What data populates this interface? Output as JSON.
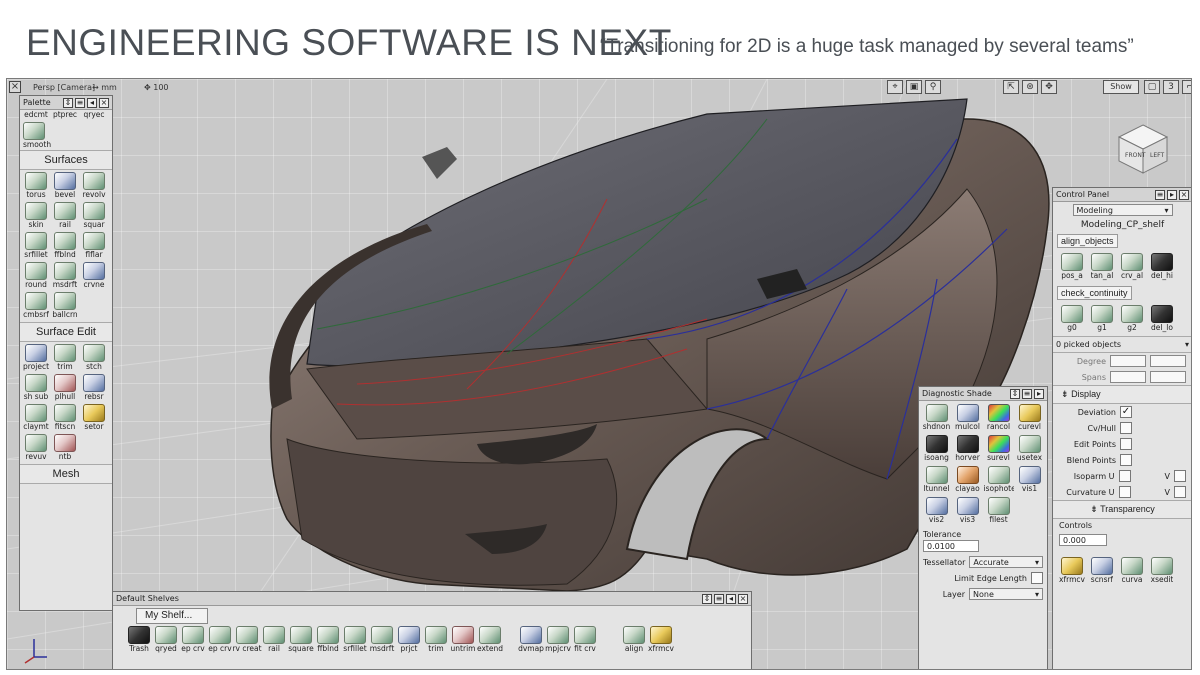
{
  "slide": {
    "title": "ENGINEERING SOFTWARE IS NEXT",
    "quote": "“Transitioning for 2D is a huge task managed by several teams”"
  },
  "viewport": {
    "camera_label": "Persp [Camera]",
    "units": "↔ mm",
    "zoom": "100",
    "show_button": "Show",
    "cube_front": "FRONT",
    "cube_left": "LEFT",
    "x_icon": "close-viewport-icon"
  },
  "palette": {
    "title": "Palette",
    "top_row": [
      "edcmt",
      "ptprec",
      "qryec"
    ],
    "smooth": "smooth",
    "surfaces_title": "Surfaces",
    "surfaces": [
      "torus",
      "bevel",
      "revolv",
      "skin",
      "rail",
      "squar",
      "srfillet",
      "ffblnd",
      "flflar",
      "round",
      "msdrft",
      "crvne",
      "cmbsrf",
      "ballcrn"
    ],
    "surface_edit_title": "Surface Edit",
    "surface_edit": [
      "project",
      "trim",
      "stch",
      "sh sub",
      "plhull",
      "rebsr",
      "claymt",
      "fitscn",
      "setor",
      "revuv",
      "ntb"
    ],
    "mesh_title": "Mesh"
  },
  "shelves": {
    "title": "Default Shelves",
    "tab": "My Shelf...",
    "tools": [
      "Trash",
      "qryed",
      "ep crv",
      "ep crv",
      "rv creat",
      "rail",
      "square",
      "ffblnd",
      "srfillet",
      "msdrft",
      "prjct",
      "trim",
      "untrim",
      "extend",
      "dvmap",
      "mpjcrv",
      "fit crv",
      "align",
      "xfrmcv"
    ]
  },
  "diagnostic": {
    "title": "Diagnostic Shade",
    "tools": [
      "shdnon",
      "mulcol",
      "rancol",
      "curevl",
      "isoang",
      "horver",
      "surevl",
      "usetex",
      "ltunnel",
      "clayao",
      "isophote",
      "vis1",
      "vis2",
      "vis3",
      "filest"
    ],
    "tolerance_label": "Tolerance",
    "tolerance_value": "0.0100",
    "tessellator_label": "Tessellator",
    "tessellator_value": "Accurate",
    "limit_edge_label": "Limit Edge Length",
    "layer_label": "Layer",
    "layer_value": "None"
  },
  "control_panel": {
    "title": "Control Panel",
    "mode": "Modeling",
    "shelf_name": "Modeling_CP_shelf",
    "section1": "align_objects",
    "align_tools": [
      "pos_a",
      "tan_al",
      "crv_al",
      "del_hi"
    ],
    "section2": "check_continuity",
    "continuity_tools": [
      "g0",
      "g1",
      "g2",
      "del_lo"
    ],
    "picked": "0 picked objects",
    "degree_label": "Degree",
    "spans_label": "Spans",
    "display_title": "Display",
    "deviation_label": "Deviation",
    "cv_hull_label": "Cv/Hull",
    "edit_points_label": "Edit Points",
    "blend_points_label": "Blend Points",
    "isoparm_label": "Isoparm U",
    "curvature_label": "Curvature U",
    "v_label": "V",
    "transparency_title": "Transparency",
    "controls_label": "Controls",
    "controls_value": "0.000",
    "bottom_tools": [
      "xfrmcv",
      "scnsrf",
      "curva",
      "xsedit"
    ]
  },
  "colors": {
    "car_body": "#6b5d56",
    "car_glass": "#55555c",
    "surface_lines_blue": "#2a2f9a",
    "surface_lines_red": "#b03030",
    "grid_bg": "#c9c9c9"
  }
}
